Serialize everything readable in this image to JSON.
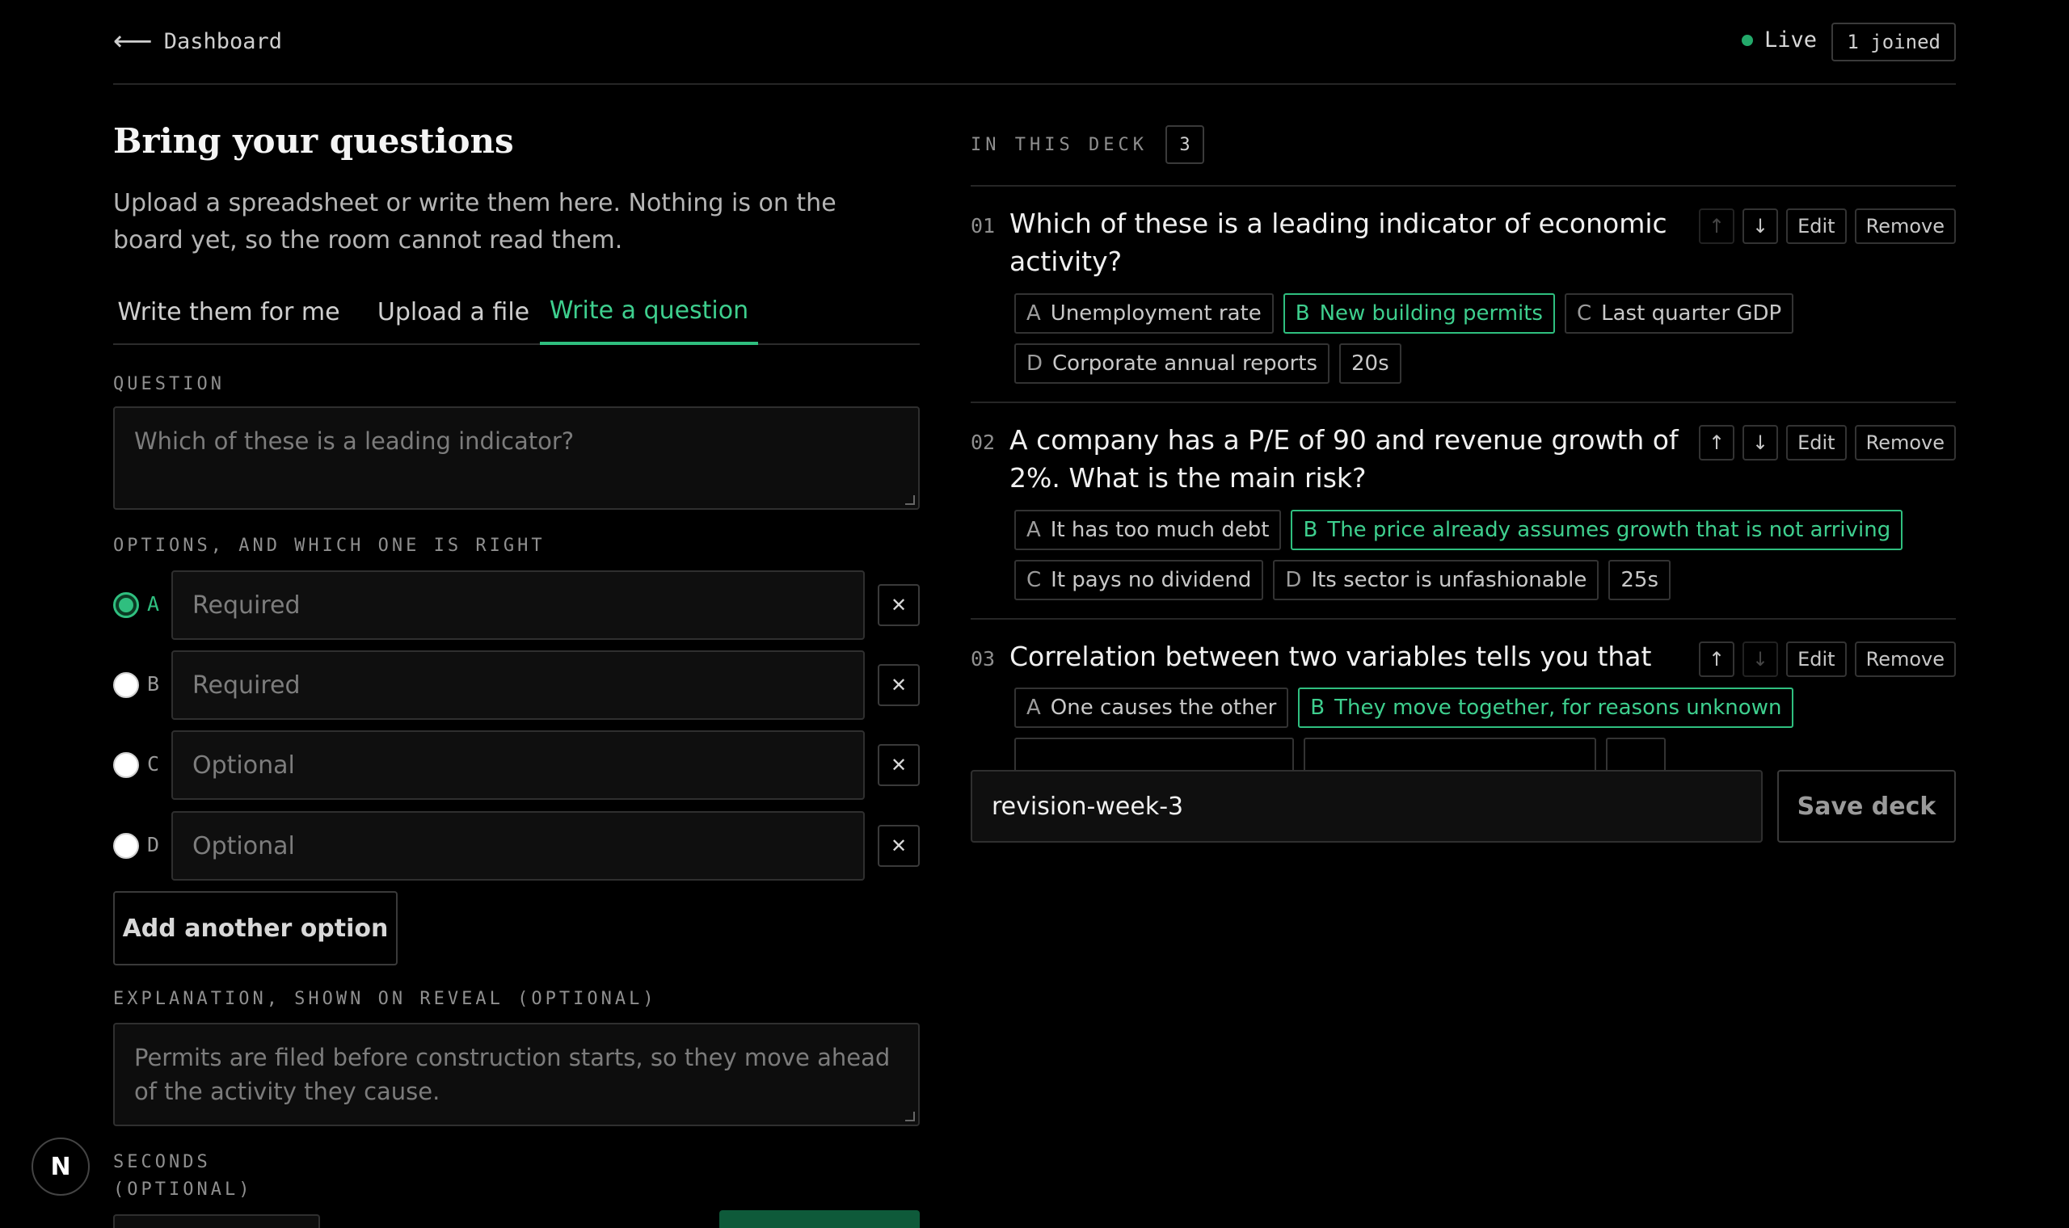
{
  "topbar": {
    "back_arrow": "⟵",
    "back_label": "Dashboard",
    "live_label": "Live",
    "joined": "1 joined"
  },
  "compose": {
    "title": "Bring your questions",
    "subtitle": "Upload a spreadsheet or write them here. Nothing is on the board yet, so the room cannot read them.",
    "tabs": [
      {
        "label": "Write them for me",
        "active": false
      },
      {
        "label": "Upload a file",
        "active": false
      },
      {
        "label": "Write a question",
        "active": true
      }
    ],
    "question_label": "QUESTION",
    "question_placeholder": "Which of these is a leading indicator?",
    "options_label": "OPTIONS, AND WHICH ONE IS RIGHT",
    "options": [
      {
        "letter": "A",
        "placeholder": "Required",
        "selected": true
      },
      {
        "letter": "B",
        "placeholder": "Required",
        "selected": false
      },
      {
        "letter": "C",
        "placeholder": "Optional",
        "selected": false
      },
      {
        "letter": "D",
        "placeholder": "Optional",
        "selected": false
      }
    ],
    "remove_glyph": "✕",
    "add_option_label": "Add another option",
    "explanation_label": "EXPLANATION, SHOWN ON REVEAL (OPTIONAL)",
    "explanation_placeholder": "Permits are filed before construction starts, so they move ahead of the activity they cause.",
    "seconds_label_1": "SECONDS",
    "seconds_label_2": "(OPTIONAL)"
  },
  "deck": {
    "label": "IN THIS DECK",
    "count": "3",
    "edit_label": "Edit",
    "remove_label": "Remove",
    "up_glyph": "↑",
    "down_glyph": "↓",
    "questions": [
      {
        "num": "01",
        "text": "Which of these is a leading indicator of economic activity?",
        "options": [
          {
            "k": "A",
            "text": "Unemployment rate",
            "correct": false
          },
          {
            "k": "B",
            "text": "New building permits",
            "correct": true
          },
          {
            "k": "C",
            "text": "Last quarter GDP",
            "correct": false
          },
          {
            "k": "D",
            "text": "Corporate annual reports",
            "correct": false
          }
        ],
        "seconds": "20s"
      },
      {
        "num": "02",
        "text": "A company has a P/E of 90 and revenue growth of 2%. What is the main risk?",
        "options": [
          {
            "k": "A",
            "text": "It has too much debt",
            "correct": false
          },
          {
            "k": "B",
            "text": "The price already assumes growth that is not arriving",
            "correct": true
          },
          {
            "k": "C",
            "text": "It pays no dividend",
            "correct": false
          },
          {
            "k": "D",
            "text": "Its sector is unfashionable",
            "correct": false
          }
        ],
        "seconds": "25s"
      },
      {
        "num": "03",
        "text": "Correlation between two variables tells you that",
        "options": [
          {
            "k": "A",
            "text": "One causes the other",
            "correct": false
          },
          {
            "k": "B",
            "text": "They move together, for reasons unknown",
            "correct": true
          }
        ]
      }
    ],
    "deck_name_value": "revision-week-3",
    "save_label": "Save deck"
  },
  "badge": {
    "letter": "N"
  }
}
